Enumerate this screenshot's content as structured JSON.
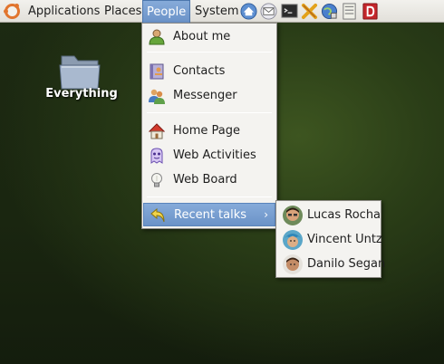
{
  "panel": {
    "menus": [
      {
        "label": "Applications"
      },
      {
        "label": "Places"
      },
      {
        "label": "People"
      },
      {
        "label": "System"
      }
    ],
    "launchers": [
      {
        "icon": "home-browser-icon"
      },
      {
        "icon": "mail-icon"
      },
      {
        "icon": "terminal-icon"
      },
      {
        "icon": "tools-icon"
      },
      {
        "icon": "globe-icon"
      },
      {
        "icon": "notes-icon"
      },
      {
        "icon": "dictionary-icon"
      }
    ]
  },
  "desktop": {
    "icons": [
      {
        "label": "Everything",
        "icon": "folder-icon"
      }
    ]
  },
  "people_menu": {
    "items": [
      {
        "label": "About me",
        "icon": "person-icon"
      },
      {
        "label": "Contacts",
        "icon": "address-book-icon"
      },
      {
        "label": "Messenger",
        "icon": "messenger-icon"
      },
      {
        "label": "Home Page",
        "icon": "home-icon"
      },
      {
        "label": "Web Activities",
        "icon": "activities-icon"
      },
      {
        "label": "Web Board",
        "icon": "lightbulb-icon"
      },
      {
        "label": "Recent talks",
        "icon": "reply-arrow-icon",
        "submenu_indicator": "›"
      }
    ]
  },
  "recent_talks": {
    "items": [
      {
        "label": "Lucas Rocha"
      },
      {
        "label": "Vincent Untz"
      },
      {
        "label": "Danilo Segan"
      }
    ]
  },
  "colors": {
    "highlight": "#6b93c8",
    "panel": "#e9e8e3",
    "ubuntu_orange": "#e1752e",
    "desktop": "#2a3d17"
  }
}
